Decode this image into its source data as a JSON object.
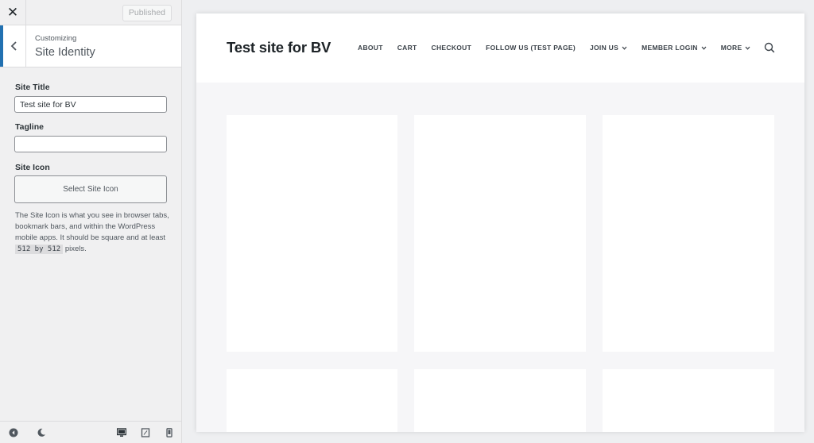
{
  "sidebar": {
    "close_glyph": "✕",
    "published_label": "Published",
    "section": {
      "crumb": "Customizing",
      "title": "Site Identity"
    },
    "site_title": {
      "label": "Site Title",
      "value": "Test site for BV"
    },
    "tagline": {
      "label": "Tagline",
      "value": ""
    },
    "site_icon": {
      "label": "Site Icon",
      "button_label": "Select Site Icon",
      "description_before": "The Site Icon is what you see in browser tabs, bookmark bars, and within the WordPress mobile apps. It should be square and at least",
      "description_code": "512 by 512",
      "description_after": "pixels."
    },
    "footer_icons": [
      "collapse-icon",
      "dark-mode-icon",
      "desktop-icon",
      "tablet-icon",
      "mobile-icon"
    ]
  },
  "preview": {
    "site_title": "Test site for BV",
    "nav": [
      {
        "label": "ABOUT",
        "has_dropdown": false
      },
      {
        "label": "CART",
        "has_dropdown": false
      },
      {
        "label": "CHECKOUT",
        "has_dropdown": false
      },
      {
        "label": "FOLLOW US (TEST PAGE)",
        "has_dropdown": false
      },
      {
        "label": "JOIN US",
        "has_dropdown": true
      },
      {
        "label": "MEMBER LOGIN",
        "has_dropdown": true
      },
      {
        "label": "MORE",
        "has_dropdown": true
      }
    ],
    "search_icon": "search-icon"
  },
  "colors": {
    "accent": "#2271b1",
    "sidebar_bg": "#f0f0f1",
    "preview_bg": "#f6f6f8",
    "text_dark": "#1d2327"
  }
}
